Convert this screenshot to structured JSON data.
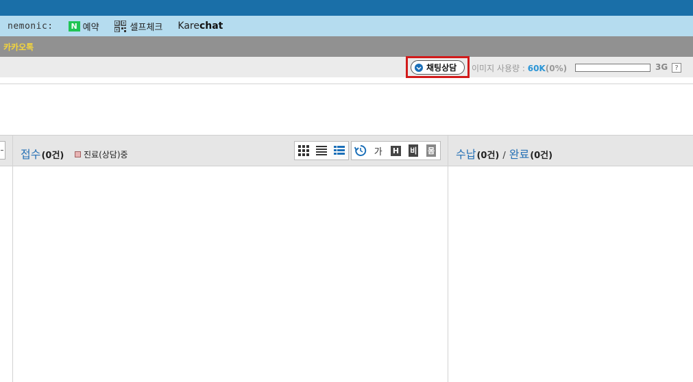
{
  "brands": {
    "nemonic": "nemonic:",
    "naver_badge": "N",
    "naver_label": "예약",
    "selfcheck_label": "셀프체크",
    "karechat_a": "Kare",
    "karechat_b": "chat"
  },
  "kakao": {
    "label": "카카오톡"
  },
  "status": {
    "chat_button": "채팅상담",
    "image_usage_label": "이미지 사용량 : ",
    "usage_value": "60K",
    "usage_percent_text": "(0%)",
    "usage_fraction": 0,
    "quota": "3G",
    "help": "?"
  },
  "reception": {
    "title": "접수",
    "count": "(0건)",
    "legend": "진료(상담)중"
  },
  "toolbar": {
    "view_grid_icon": "grid-view-icon",
    "view_list_icon": "list-view-icon",
    "view_detail_icon": "detail-view-icon",
    "refresh_icon": "refresh-icon",
    "font_label": "가",
    "h_label": "H",
    "b_label": "비",
    "m_label": "몸"
  },
  "payment": {
    "title": "수납",
    "count": "(0건)",
    "sep": "/",
    "done_title": "완료",
    "done_count": "(0건)"
  },
  "colors": {
    "topbar": "#1a6fa8",
    "brandbar": "#b5dcef",
    "kakao_text": "#f5d63a",
    "title_blue": "#2570b5",
    "usage_blue": "#2a95d6",
    "highlight_red": "#d11a1a"
  }
}
